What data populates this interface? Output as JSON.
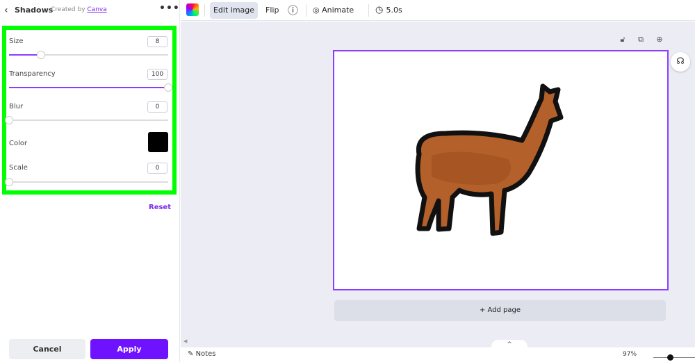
{
  "left_panel": {
    "title": "Shadows",
    "created_by": "Created by",
    "creator_link": "Canva",
    "more": "•••",
    "back": "‹",
    "controls": {
      "size": {
        "label": "Size",
        "value": "8",
        "slider_fraction": 0.2
      },
      "transparency": {
        "label": "Transparency",
        "value": "100",
        "slider_fraction": 1.0
      },
      "blur": {
        "label": "Blur",
        "value": "0",
        "slider_fraction": 0.0
      },
      "color": {
        "label": "Color",
        "value": "#000000"
      },
      "scale": {
        "label": "Scale",
        "value": "0",
        "slider_fraction": 0.0
      }
    },
    "reset": "Reset",
    "cancel": "Cancel",
    "apply": "Apply"
  },
  "toolbar": {
    "edit_image": "Edit image",
    "flip": "Flip",
    "info": "ⓘ",
    "animate": "Animate",
    "duration": "5.0s"
  },
  "canvas": {
    "add_page": "+ Add page",
    "page_tools": [
      "lock-icon",
      "duplicate-icon",
      "add-page-icon"
    ],
    "image_subject": "alpaca"
  },
  "bottom": {
    "notes": "Notes",
    "zoom": "97%",
    "collapse": "^"
  },
  "colors": {
    "accent": "#8b3dff",
    "apply_bg": "#6f12ff",
    "highlight": "#00ff00"
  }
}
